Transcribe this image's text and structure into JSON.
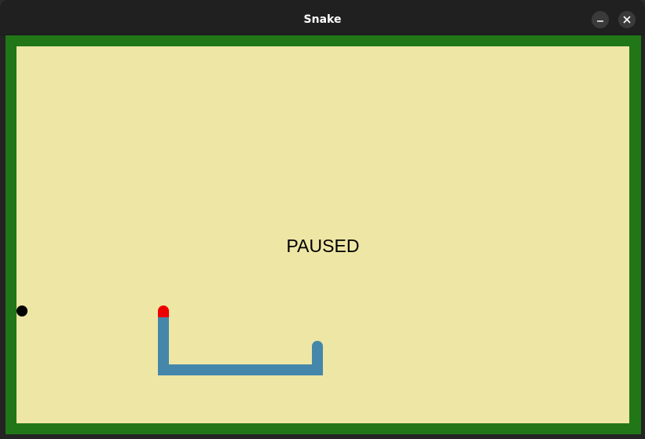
{
  "window": {
    "title": "Snake",
    "minimize_icon": "minimize-icon",
    "close_icon": "close-icon"
  },
  "game": {
    "status_text": "PAUSED",
    "colors": {
      "border": "#217717",
      "field": "#eee6a5",
      "snake_body": "#4587aa",
      "snake_head": "#ee0000",
      "food": "#000000",
      "text": "#000000"
    }
  }
}
